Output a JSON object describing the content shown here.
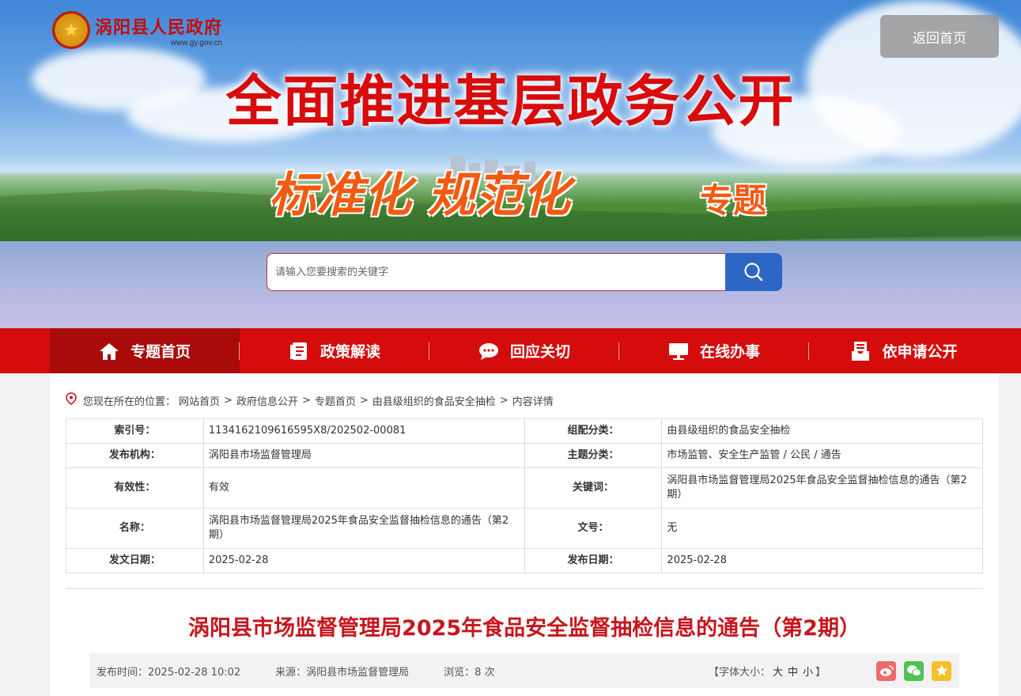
{
  "header": {
    "site_name": "涡阳县人民政府",
    "site_url": "www.gy.gov.cn",
    "back_home": "返回首页",
    "main_title": "全面推进基层政务公开",
    "sub_title": "标准化 规范化",
    "sub_tag": "专题",
    "search_placeholder": "请输入您要搜索的关键字"
  },
  "nav": {
    "items": [
      {
        "label": "专题首页",
        "icon": "home-icon"
      },
      {
        "label": "政策解读",
        "icon": "document-icon"
      },
      {
        "label": "回应关切",
        "icon": "chat-icon"
      },
      {
        "label": "在线办事",
        "icon": "monitor-icon"
      },
      {
        "label": "依申请公开",
        "icon": "inbox-icon"
      }
    ]
  },
  "breadcrumb": {
    "prefix": "您现在所在的位置：",
    "items": [
      "网站首页",
      "政府信息公开",
      "专题首页",
      "由县级组织的食品安全抽检",
      "内容详情"
    ]
  },
  "meta": {
    "rows": [
      {
        "k1": "索引号：",
        "v1": "1134162109616595X8/202502-00081",
        "k2": "组配分类：",
        "v2": "由县级组织的食品安全抽检"
      },
      {
        "k1": "发布机构：",
        "v1": "涡阳县市场监督管理局",
        "k2": "主题分类：",
        "v2": "市场监管、安全生产监管 / 公民 / 通告"
      },
      {
        "k1": "有效性：",
        "v1": "有效",
        "k2": "关键词：",
        "v2": "涡阳县市场监督管理局2025年食品安全监督抽检信息的通告（第2期）"
      },
      {
        "k1": "名称：",
        "v1": "涡阳县市场监督管理局2025年食品安全监督抽检信息的通告（第2期）",
        "k2": "文号：",
        "v2": "无"
      },
      {
        "k1": "发文日期：",
        "v1": "2025-02-28",
        "k2": "发布日期：",
        "v2": "2025-02-28"
      }
    ]
  },
  "article": {
    "title": "涡阳县市场监督管理局2025年食品安全监督抽检信息的通告（第2期）",
    "publish_time": "发布时间：2025-02-28 10:02",
    "source": "来源：涡阳县市场监督管理局",
    "views": "浏览：8 次",
    "font_label_open": "【字体大小：",
    "font_large": "大",
    "font_medium": "中",
    "font_small": "小",
    "font_label_close": "】"
  },
  "colors": {
    "brand_red": "#d40c0c",
    "nav_active": "#a90a0a",
    "search_blue": "#2d66c4",
    "title_red": "#c8161d"
  }
}
